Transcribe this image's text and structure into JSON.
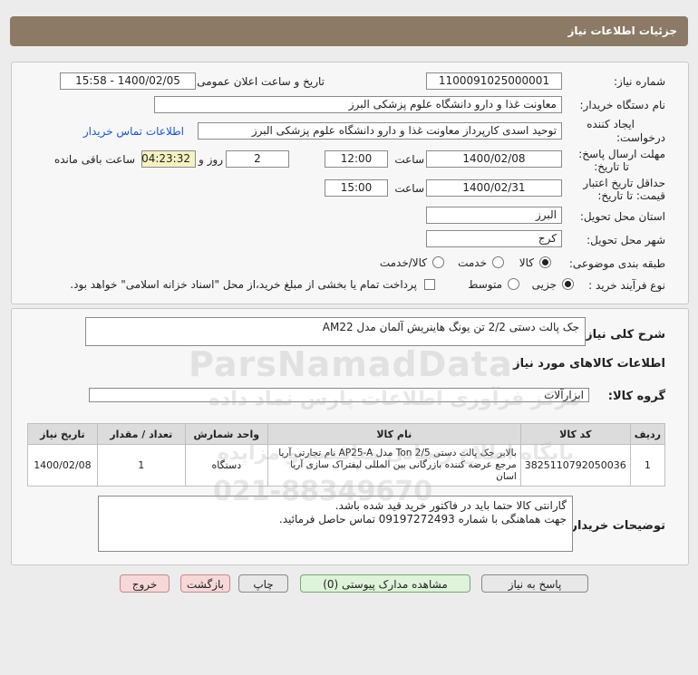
{
  "page_title": "جزئیات اطلاعات نیاز",
  "fields": {
    "need_number_label": "شماره نیاز:",
    "need_number": "1100091025000001",
    "announce_label": "تاریخ و ساعت اعلان عمومی:",
    "announce_value": "1400/02/05 - 15:58",
    "buyer_org_label": "نام دستگاه خریدار:",
    "buyer_org": "معاونت غذا و دارو دانشگاه علوم پزشکی البرز",
    "creator_label_1": "ایجاد کننده",
    "creator_label_2": "درخواست:",
    "creator": "توحید اسدی کارپرداز معاونت غذا و دارو دانشگاه علوم پزشکی البرز",
    "contact_link": "اطلاعات تماس خریدار",
    "deadline_label_1": "مهلت ارسال پاسخ:",
    "deadline_label_2": "تا تاریخ:",
    "deadline_date": "1400/02/08",
    "time_label": "ساعت",
    "deadline_time": "12:00",
    "days": "2",
    "days_label": "روز و",
    "remaining": "04:23:32",
    "remaining_label": "ساعت باقی مانده",
    "validity_label_1": "حداقل تاریخ اعتبار",
    "validity_label_2": "قیمت: تا تاریخ:",
    "validity_date": "1400/02/31",
    "validity_time": "15:00",
    "province_label": "استان محل تحویل:",
    "province": "البرز",
    "city_label": "شهر محل تحویل:",
    "city": "کرج",
    "category_label": "طبقه بندی موضوعی:",
    "category_options": [
      "کالا",
      "خدمت",
      "کالا/خدمت"
    ],
    "purchase_type_label": "نوع فرآیند خرید :",
    "purchase_options": [
      "جزیی",
      "متوسط"
    ],
    "treasury_note": "پرداخت تمام یا بخشی از مبلغ خرید،از محل \"اسناد خزانه اسلامی\" خواهد بود."
  },
  "summary": {
    "label": "شرح کلی نیاز:",
    "text": "جک پالت دستی 2/2 تن یونگ هاینریش آلمان مدل AM22"
  },
  "goods": {
    "section_title": "اطلاعات کالاهای مورد نیاز",
    "group_label": "گروه کالا:",
    "group_value": "ابزارآلات",
    "columns": [
      "ردیف",
      "کد کالا",
      "نام کالا",
      "واحد شمارش",
      "تعداد / مقدار",
      "تاریخ نیاز"
    ],
    "rows": [
      {
        "row": "1",
        "code": "3825110792050036",
        "name": "بالابر جک پالت دستی 2/5 Ton مدل AP25-A نام تجارتی آریا مرجع عرضه کننده بازرگانی بین المللی لیفتراک سازی آریا اسان",
        "unit": "دستگاه",
        "qty": "1",
        "date": "1400/02/08"
      }
    ]
  },
  "buyer_notes": {
    "label": "توضیحات خریدار:",
    "line1": "گارانتی کالا حتما باید در فاکتور خرید قید شده باشد.",
    "line2": "جهت هماهنگی با شماره 09197272493 تماس حاصل فرمائید."
  },
  "buttons": {
    "reply": "پاسخ به نیاز",
    "attachments": "مشاهده مدارک پیوستی (0)",
    "print": "چاپ",
    "back": "بازگشت",
    "exit": "خروج"
  },
  "watermark": {
    "brand": "ParsNamadData",
    "fa_line1": "مرکز فرآوری اطلاعات پارس نماد داده",
    "fa_line2": "پایگاه اطلاع رسانی مناقصه و مزایده",
    "phone": "021-88349670"
  }
}
